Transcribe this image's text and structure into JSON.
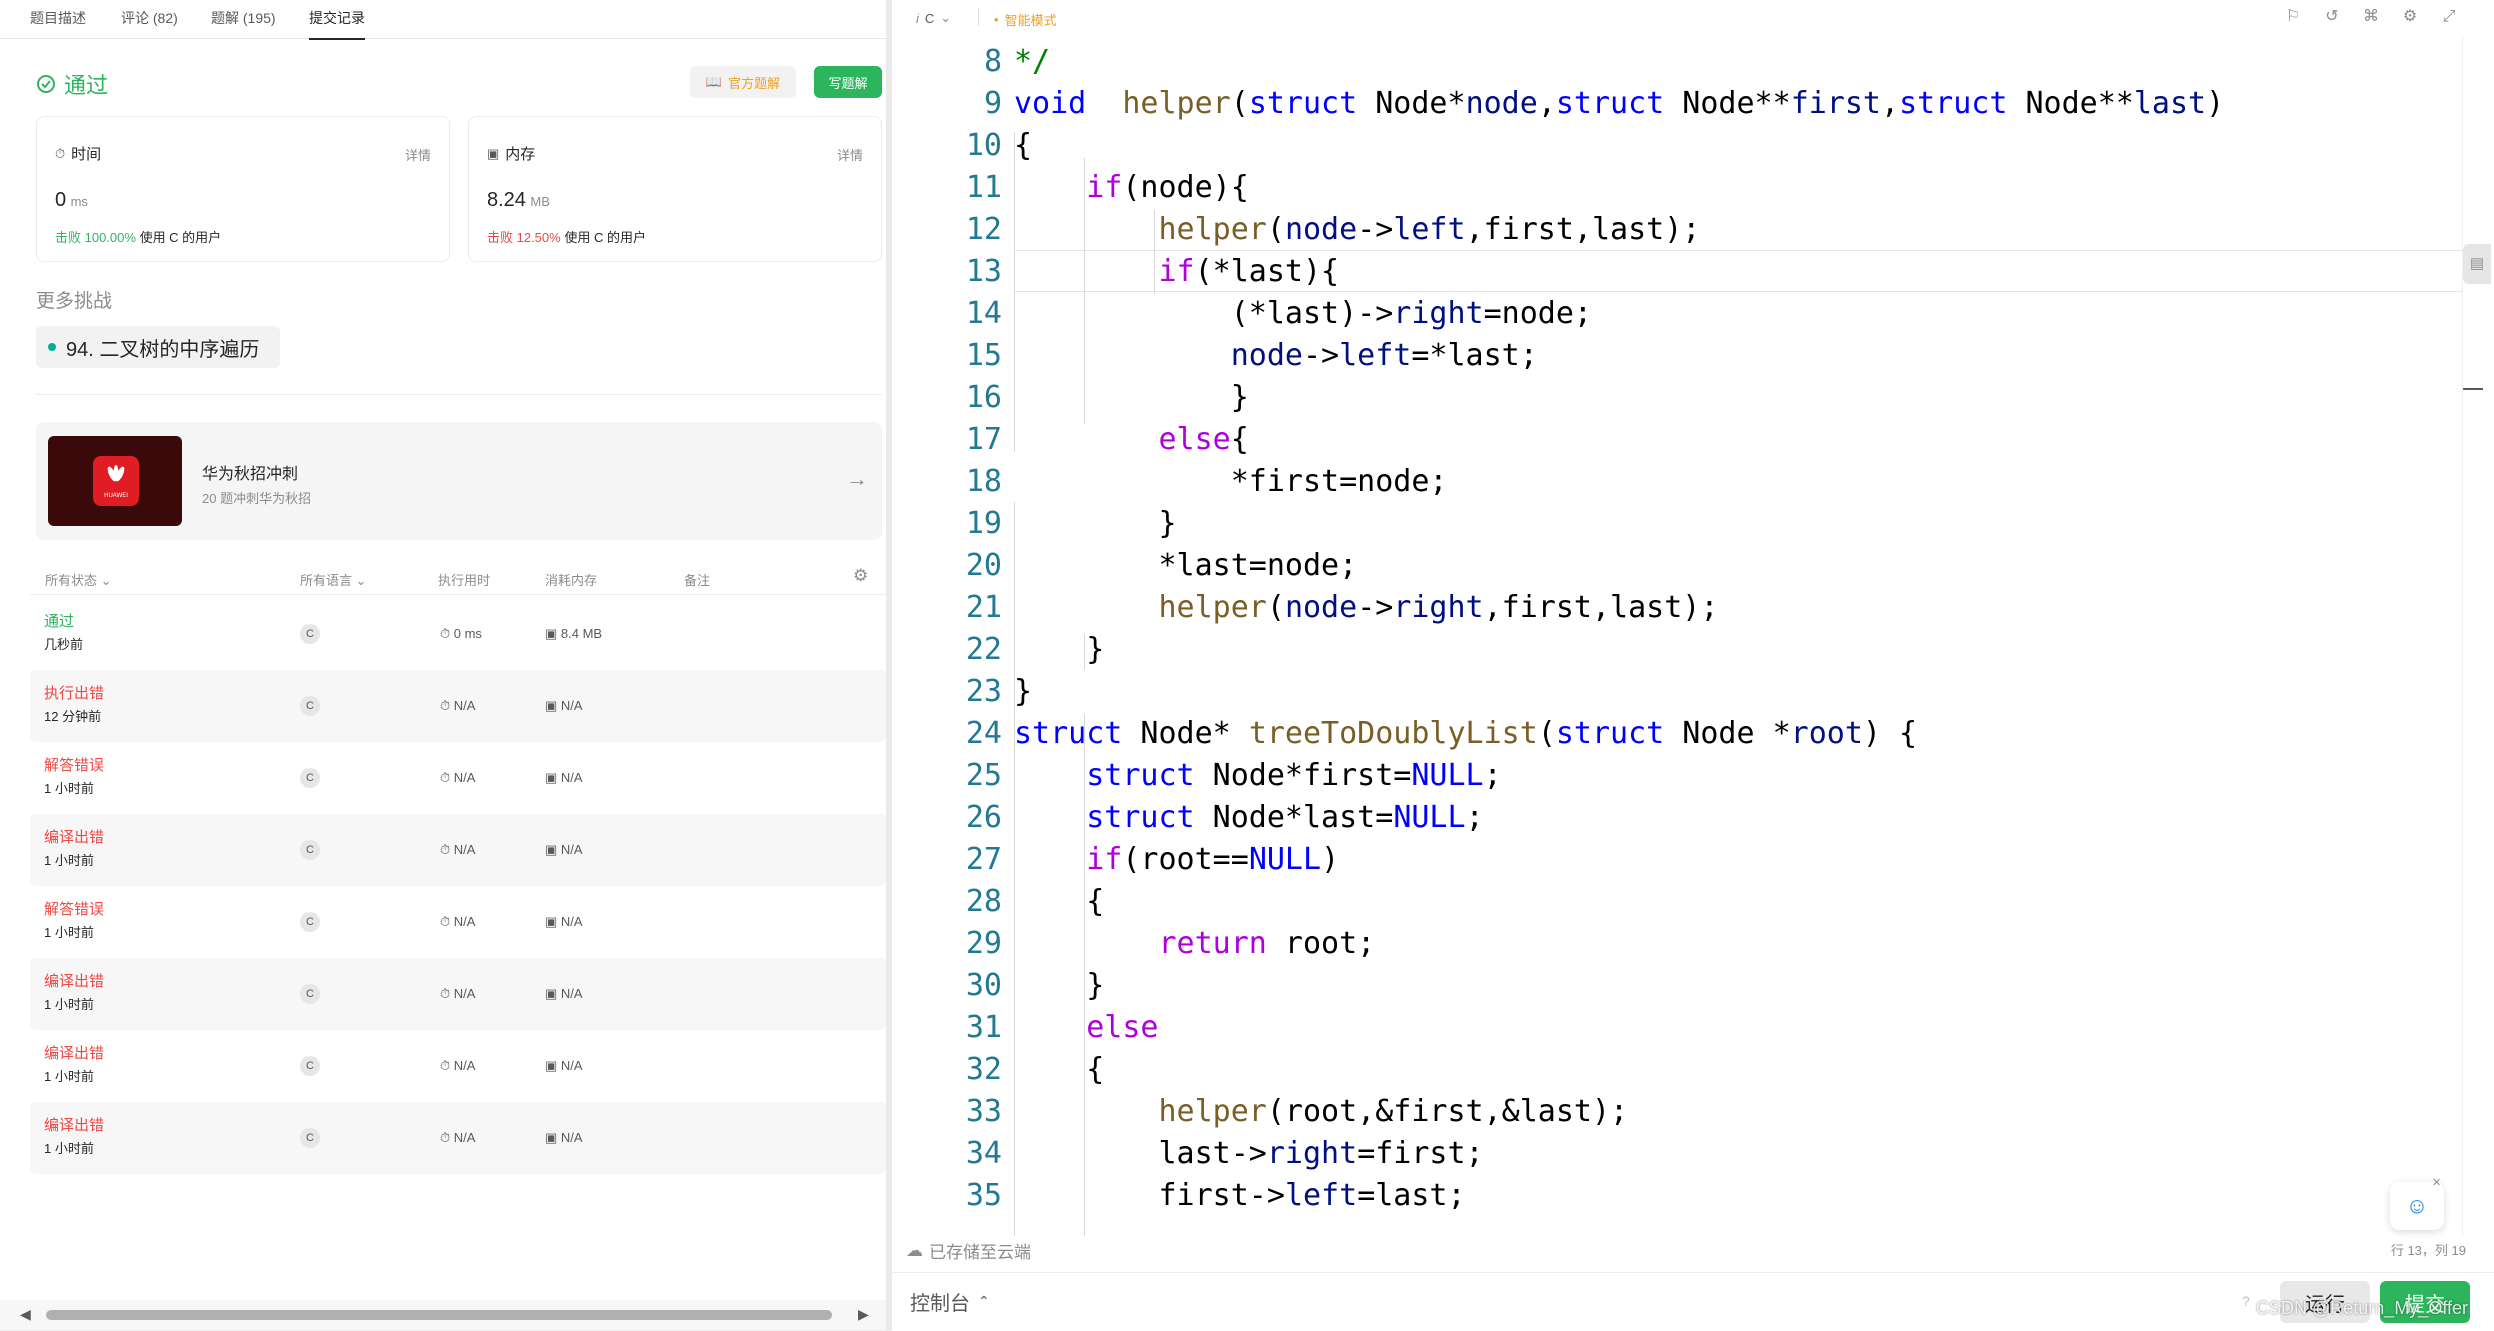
{
  "tabs": [
    "题目描述",
    "评论 (82)",
    "题解 (195)",
    "提交记录"
  ],
  "result": {
    "status": "通过",
    "official_solution": "官方题解",
    "write_solution": "写题解"
  },
  "time_card": {
    "label": "时间",
    "detail": "详情",
    "value": "0",
    "unit": "ms",
    "beat_pct": "击败 100.00%",
    "beat_text": "使用 C 的用户"
  },
  "memory_card": {
    "label": "内存",
    "detail": "详情",
    "value": "8.24",
    "unit": "MB",
    "beat_pct": "击败 12.50%",
    "beat_text": "使用 C 的用户"
  },
  "more": {
    "title": "更多挑战",
    "chip": "94. 二叉树的中序遍历"
  },
  "promo": {
    "logo_text": "HUAWEI",
    "title": "华为秋招冲刺",
    "subtitle": "20 题冲刺华为秋招"
  },
  "table_headers": [
    "所有状态",
    "所有语言",
    "执行用时",
    "消耗内存",
    "备注"
  ],
  "submissions": [
    {
      "status": "通过",
      "ok": true,
      "time": "几秒前",
      "lang": "C",
      "runtime": "0 ms",
      "memory": "8.4 MB"
    },
    {
      "status": "执行出错",
      "ok": false,
      "time": "12 分钟前",
      "lang": "C",
      "runtime": "N/A",
      "memory": "N/A"
    },
    {
      "status": "解答错误",
      "ok": false,
      "time": "1 小时前",
      "lang": "C",
      "runtime": "N/A",
      "memory": "N/A"
    },
    {
      "status": "编译出错",
      "ok": false,
      "time": "1 小时前",
      "lang": "C",
      "runtime": "N/A",
      "memory": "N/A"
    },
    {
      "status": "解答错误",
      "ok": false,
      "time": "1 小时前",
      "lang": "C",
      "runtime": "N/A",
      "memory": "N/A"
    },
    {
      "status": "编译出错",
      "ok": false,
      "time": "1 小时前",
      "lang": "C",
      "runtime": "N/A",
      "memory": "N/A"
    },
    {
      "status": "编译出错",
      "ok": false,
      "time": "1 小时前",
      "lang": "C",
      "runtime": "N/A",
      "memory": "N/A"
    },
    {
      "status": "编译出错",
      "ok": false,
      "time": "1 小时前",
      "lang": "C",
      "runtime": "N/A",
      "memory": "N/A"
    }
  ],
  "editor": {
    "language": "C",
    "mode": "智能模式",
    "saved": "已存储至云端",
    "cursor": "行 13，列 19",
    "first_line": 8,
    "lines": [
      [
        [
          "cmt",
          "*/"
        ]
      ],
      [
        [
          "kw",
          "void"
        ],
        [
          "",
          "  "
        ],
        [
          "fn",
          "helper"
        ],
        [
          "",
          "("
        ],
        [
          "kw",
          "struct"
        ],
        [
          "",
          " Node*"
        ],
        [
          "var",
          "node"
        ],
        [
          "",
          ","
        ],
        [
          "kw",
          "struct"
        ],
        [
          "",
          " Node**"
        ],
        [
          "var",
          "first"
        ],
        [
          "",
          ","
        ],
        [
          "kw",
          "struct"
        ],
        [
          "",
          " Node**"
        ],
        [
          "var",
          "last"
        ],
        [
          "",
          ")"
        ]
      ],
      [
        [
          "",
          "{"
        ]
      ],
      [
        [
          "",
          "    "
        ],
        [
          "ctl",
          "if"
        ],
        [
          "",
          "(node){"
        ]
      ],
      [
        [
          "",
          "        "
        ],
        [
          "fn",
          "helper"
        ],
        [
          "",
          "("
        ],
        [
          "var",
          "node"
        ],
        [
          "",
          "->"
        ],
        [
          "var",
          "left"
        ],
        [
          "",
          ",first,last);"
        ]
      ],
      [
        [
          "",
          "        "
        ],
        [
          "ctl",
          "if"
        ],
        [
          "",
          "(*last){"
        ]
      ],
      [
        [
          "",
          "            (*last)->"
        ],
        [
          "var",
          "right"
        ],
        [
          "",
          "=node;"
        ]
      ],
      [
        [
          "",
          "            "
        ],
        [
          "var",
          "node"
        ],
        [
          "",
          "->"
        ],
        [
          "var",
          "left"
        ],
        [
          "",
          "=*last;"
        ]
      ],
      [
        [
          "",
          "            }"
        ]
      ],
      [
        [
          "",
          "        "
        ],
        [
          "ctl",
          "else"
        ],
        [
          "",
          "{"
        ]
      ],
      [
        [
          "",
          "            *first=node;"
        ]
      ],
      [
        [
          "",
          "        }"
        ]
      ],
      [
        [
          "",
          "        *last=node;"
        ]
      ],
      [
        [
          "",
          "        "
        ],
        [
          "fn",
          "helper"
        ],
        [
          "",
          "("
        ],
        [
          "var",
          "node"
        ],
        [
          "",
          "->"
        ],
        [
          "var",
          "right"
        ],
        [
          "",
          ",first,last);"
        ]
      ],
      [
        [
          "",
          "    }"
        ]
      ],
      [
        [
          "",
          "}"
        ]
      ],
      [
        [
          "kw",
          "struct"
        ],
        [
          "",
          " Node* "
        ],
        [
          "fn",
          "treeToDoublyList"
        ],
        [
          "",
          "("
        ],
        [
          "kw",
          "struct"
        ],
        [
          "",
          " Node *"
        ],
        [
          "var",
          "root"
        ],
        [
          "",
          ") {"
        ]
      ],
      [
        [
          "",
          "    "
        ],
        [
          "kw",
          "struct"
        ],
        [
          "",
          " Node*first="
        ],
        [
          "kw",
          "NULL"
        ],
        [
          "",
          ";"
        ]
      ],
      [
        [
          "",
          "    "
        ],
        [
          "kw",
          "struct"
        ],
        [
          "",
          " Node*last="
        ],
        [
          "kw",
          "NULL"
        ],
        [
          "",
          ";"
        ]
      ],
      [
        [
          "",
          "    "
        ],
        [
          "ctl",
          "if"
        ],
        [
          "",
          "(root=="
        ],
        [
          "kw",
          "NULL"
        ],
        [
          "",
          ")"
        ]
      ],
      [
        [
          "",
          "    {"
        ]
      ],
      [
        [
          "",
          "        "
        ],
        [
          "ctl",
          "return"
        ],
        [
          "",
          " root;"
        ]
      ],
      [
        [
          "",
          "    }"
        ]
      ],
      [
        [
          "",
          "    "
        ],
        [
          "ctl",
          "else"
        ]
      ],
      [
        [
          "",
          "    {"
        ]
      ],
      [
        [
          "",
          "        "
        ],
        [
          "fn",
          "helper"
        ],
        [
          "",
          "(root,&first,&last);"
        ]
      ],
      [
        [
          "",
          "        last->"
        ],
        [
          "var",
          "right"
        ],
        [
          "",
          "=first;"
        ]
      ],
      [
        [
          "",
          "        first->"
        ],
        [
          "var",
          "left"
        ],
        [
          "",
          "=last;"
        ]
      ]
    ]
  },
  "bottom": {
    "console": "控制台",
    "run": "运行",
    "submit": "提交",
    "watermark": "CSDN @Return_My_Offer"
  },
  "colors": {
    "accent_green": "#2db55d",
    "error_red": "#ef4743",
    "official_orange": "#f0a020"
  }
}
